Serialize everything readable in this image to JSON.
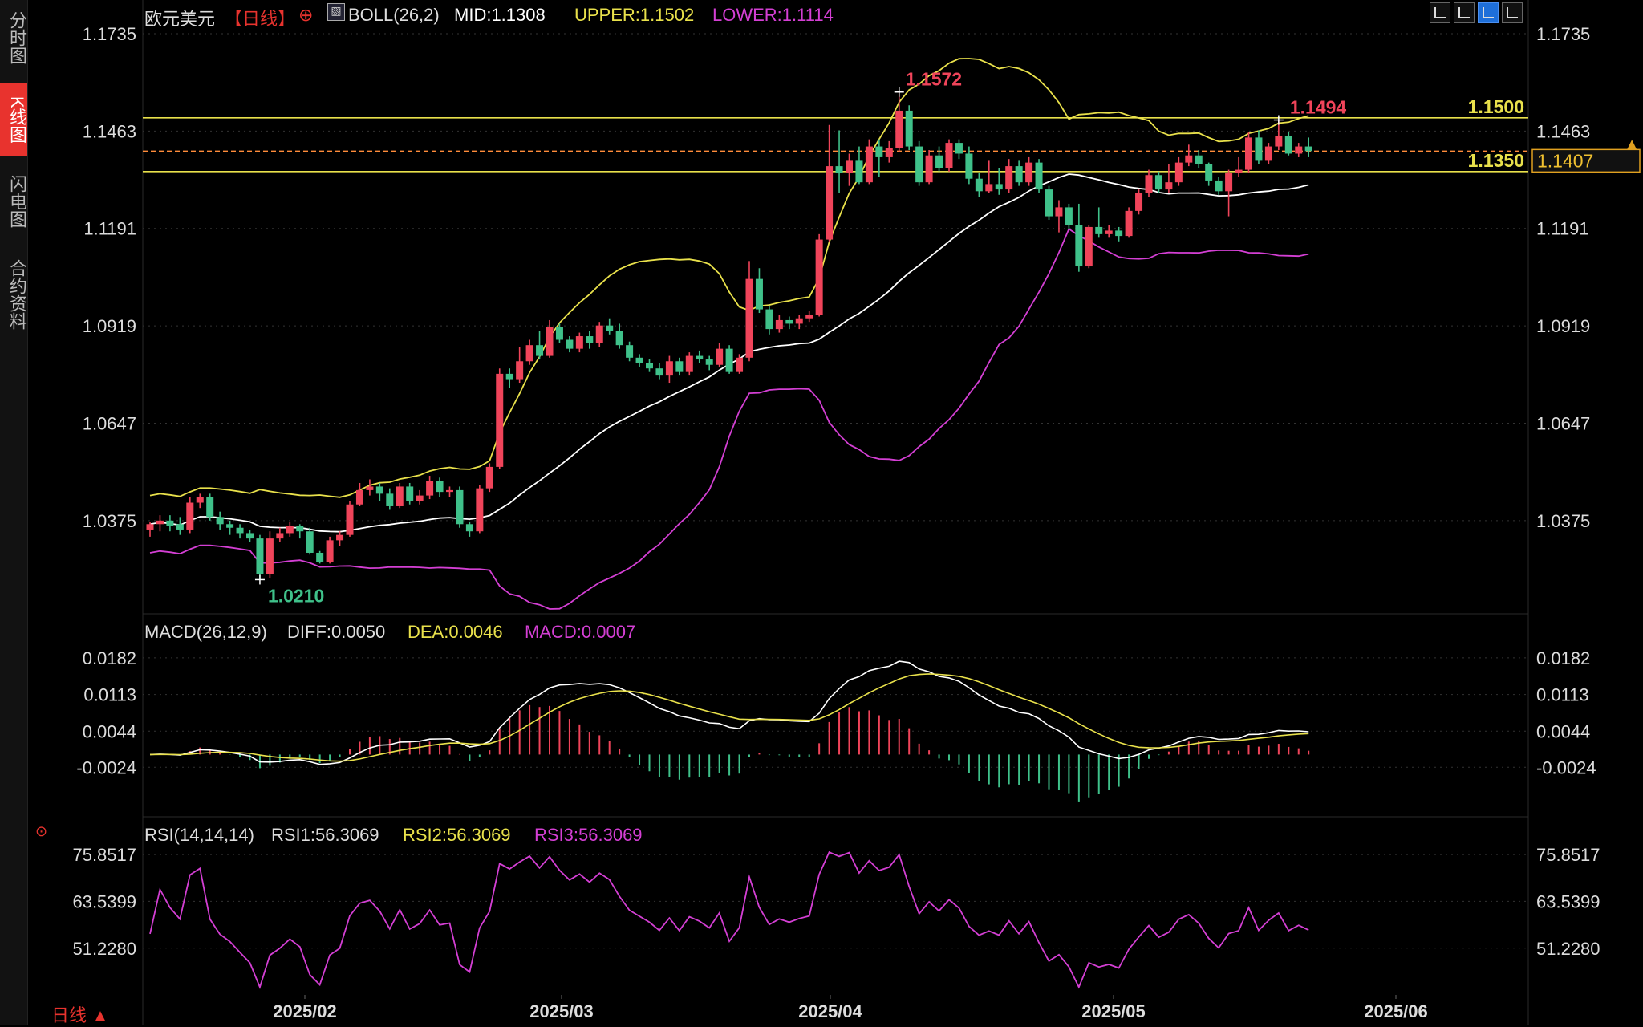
{
  "side_tabs": [
    {
      "label": "分时图",
      "active": false
    },
    {
      "label": "K线图",
      "active": true
    },
    {
      "label": "闪电图",
      "active": false
    },
    {
      "label": "合约资料",
      "active": false
    }
  ],
  "header": {
    "symbol": "欧元美元",
    "period_tag": "【日线】",
    "boll_label": "BOLL(26,2)",
    "mid_label": "MID:1.1308",
    "upper_label": "UPPER:1.1502",
    "lower_label": "LOWER:1.1114"
  },
  "macd_header": {
    "name": "MACD(26,12,9)",
    "diff_label": "DIFF:0.0050",
    "dea_label": "DEA:0.0046",
    "macd_label": "MACD:0.0007"
  },
  "rsi_header": {
    "name": "RSI(14,14,14)",
    "rsi1_label": "RSI1:56.3069",
    "rsi2_label": "RSI2:56.3069",
    "rsi3_label": "RSI3:56.3069"
  },
  "bottom": {
    "period_label": "日线 ▲"
  },
  "colors": {
    "up": "#f0445a",
    "down": "#3fc18a",
    "mid": "#ffffff",
    "upper": "#e9e14b",
    "lower": "#d43fd4",
    "grid": "#333333",
    "hline": "#e9e14b",
    "last_line": "#ff8c3a"
  },
  "chart_data": [
    {
      "type": "candlestick",
      "panel": "price",
      "y_ticks": [
        "1.1735",
        "1.1463",
        "1.1191",
        "1.0919",
        "1.0647",
        "1.0375"
      ],
      "ylim": [
        1.0211,
        1.1735
      ],
      "x_ticks": [
        "2025/02",
        "2025/03",
        "2025/04",
        "2025/05",
        "2025/06"
      ],
      "annotations": {
        "high": "1.1572",
        "low": "1.0210",
        "recent_high": "1.1494"
      },
      "horizontal_lines": [
        {
          "label": "1.1500",
          "value": 1.15
        },
        {
          "label": "1.1350",
          "value": 1.135
        }
      ],
      "last_price": {
        "label": "1.1407",
        "value": 1.1407
      },
      "candles": [
        [
          1.035,
          1.0365,
          1.033,
          1.037
        ],
        [
          1.0365,
          1.0375,
          1.0345,
          1.039
        ],
        [
          1.0375,
          1.036,
          1.0345,
          1.039
        ],
        [
          1.0365,
          1.035,
          1.0335,
          1.0385
        ],
        [
          1.035,
          1.0425,
          1.034,
          1.044
        ],
        [
          1.0425,
          1.044,
          1.041,
          1.045
        ],
        [
          1.044,
          1.0385,
          1.0375,
          1.045
        ],
        [
          1.0385,
          1.0365,
          1.035,
          1.04
        ],
        [
          1.0365,
          1.0355,
          1.0335,
          1.0375
        ],
        [
          1.0355,
          1.034,
          1.0325,
          1.0365
        ],
        [
          1.034,
          1.0325,
          1.0315,
          1.035
        ],
        [
          1.0325,
          1.0225,
          1.021,
          1.0335
        ],
        [
          1.0225,
          1.0325,
          1.0215,
          1.0345
        ],
        [
          1.0325,
          1.034,
          1.0315,
          1.0355
        ],
        [
          1.034,
          1.036,
          1.033,
          1.037
        ],
        [
          1.036,
          1.0345,
          1.0325,
          1.0365
        ],
        [
          1.0345,
          1.0285,
          1.028,
          1.0355
        ],
        [
          1.0285,
          1.026,
          1.0255,
          1.029
        ],
        [
          1.026,
          1.032,
          1.0255,
          1.033
        ],
        [
          1.032,
          1.0335,
          1.0305,
          1.0345
        ],
        [
          1.0335,
          1.042,
          1.033,
          1.043
        ],
        [
          1.042,
          1.046,
          1.0415,
          1.048
        ],
        [
          1.046,
          1.047,
          1.0445,
          1.049
        ],
        [
          1.047,
          1.045,
          1.043,
          1.048
        ],
        [
          1.045,
          1.0415,
          1.0405,
          1.0465
        ],
        [
          1.0415,
          1.047,
          1.041,
          1.048
        ],
        [
          1.047,
          1.043,
          1.042,
          1.048
        ],
        [
          1.043,
          1.0445,
          1.042,
          1.046
        ],
        [
          1.0445,
          1.0485,
          1.0435,
          1.05
        ],
        [
          1.0485,
          1.0455,
          1.044,
          1.0495
        ],
        [
          1.0455,
          1.046,
          1.044,
          1.047
        ],
        [
          1.046,
          1.0365,
          1.0355,
          1.047
        ],
        [
          1.0365,
          1.0345,
          1.033,
          1.037
        ],
        [
          1.0345,
          1.0465,
          1.034,
          1.0475
        ],
        [
          1.0465,
          1.0525,
          1.0455,
          1.0535
        ],
        [
          1.0525,
          1.0785,
          1.052,
          1.08
        ],
        [
          1.0785,
          1.077,
          1.0745,
          1.08
        ],
        [
          1.077,
          1.082,
          1.076,
          1.086
        ],
        [
          1.082,
          1.0865,
          1.081,
          1.088
        ],
        [
          1.0865,
          1.0835,
          1.0825,
          1.0905
        ],
        [
          1.0835,
          1.0915,
          1.083,
          1.0935
        ],
        [
          1.0915,
          1.088,
          1.087,
          1.0925
        ],
        [
          1.088,
          1.0855,
          1.0845,
          1.089
        ],
        [
          1.0855,
          1.089,
          1.0845,
          1.09
        ],
        [
          1.089,
          1.087,
          1.0855,
          1.0905
        ],
        [
          1.087,
          1.092,
          1.086,
          1.093
        ],
        [
          1.092,
          1.0905,
          1.0895,
          1.094
        ],
        [
          1.0905,
          1.0865,
          1.0855,
          1.0925
        ],
        [
          1.0865,
          1.083,
          1.082,
          1.0875
        ],
        [
          1.083,
          1.0815,
          1.0805,
          1.084
        ],
        [
          1.0815,
          1.08,
          1.079,
          1.0825
        ],
        [
          1.08,
          1.078,
          1.077,
          1.0815
        ],
        [
          1.078,
          1.082,
          1.076,
          1.0835
        ],
        [
          1.082,
          1.079,
          1.078,
          1.083
        ],
        [
          1.079,
          1.0835,
          1.078,
          1.0845
        ],
        [
          1.0835,
          1.0825,
          1.0815,
          1.085
        ],
        [
          1.0825,
          1.081,
          1.0795,
          1.0835
        ],
        [
          1.081,
          1.0855,
          1.0805,
          1.087
        ],
        [
          1.0855,
          1.079,
          1.0785,
          1.0865
        ],
        [
          1.079,
          1.083,
          1.0785,
          1.084
        ],
        [
          1.083,
          1.105,
          1.082,
          1.11
        ],
        [
          1.105,
          1.0965,
          1.0955,
          1.108
        ],
        [
          1.0965,
          1.091,
          1.0895,
          1.0975
        ],
        [
          1.091,
          1.0935,
          1.09,
          1.095
        ],
        [
          1.0935,
          1.0925,
          1.091,
          1.0945
        ],
        [
          1.0925,
          1.094,
          1.091,
          1.095
        ],
        [
          1.094,
          1.095,
          1.093,
          1.096
        ],
        [
          1.095,
          1.116,
          1.0945,
          1.1175
        ],
        [
          1.116,
          1.1365,
          1.1155,
          1.148
        ],
        [
          1.1365,
          1.1345,
          1.129,
          1.1465
        ],
        [
          1.1345,
          1.138,
          1.131,
          1.14
        ],
        [
          1.138,
          1.132,
          1.1315,
          1.142
        ],
        [
          1.132,
          1.142,
          1.1315,
          1.144
        ],
        [
          1.142,
          1.139,
          1.1335,
          1.144
        ],
        [
          1.139,
          1.1415,
          1.1375,
          1.1435
        ],
        [
          1.1415,
          1.152,
          1.1405,
          1.1572
        ],
        [
          1.152,
          1.142,
          1.141,
          1.1535
        ],
        [
          1.142,
          1.132,
          1.131,
          1.1435
        ],
        [
          1.132,
          1.1395,
          1.1315,
          1.141
        ],
        [
          1.1395,
          1.136,
          1.135,
          1.142
        ],
        [
          1.136,
          1.143,
          1.135,
          1.144
        ],
        [
          1.143,
          1.14,
          1.1385,
          1.144
        ],
        [
          1.14,
          1.133,
          1.1315,
          1.142
        ],
        [
          1.133,
          1.1295,
          1.128,
          1.1345
        ],
        [
          1.1295,
          1.1315,
          1.129,
          1.138
        ],
        [
          1.1315,
          1.13,
          1.1285,
          1.136
        ],
        [
          1.13,
          1.1365,
          1.129,
          1.1385
        ],
        [
          1.1365,
          1.132,
          1.131,
          1.138
        ],
        [
          1.132,
          1.1375,
          1.131,
          1.139
        ],
        [
          1.1375,
          1.13,
          1.129,
          1.1385
        ],
        [
          1.13,
          1.1225,
          1.1215,
          1.131
        ],
        [
          1.1225,
          1.125,
          1.118,
          1.127
        ],
        [
          1.125,
          1.12,
          1.119,
          1.126
        ],
        [
          1.12,
          1.1085,
          1.107,
          1.126
        ],
        [
          1.1085,
          1.1195,
          1.108,
          1.12
        ],
        [
          1.1195,
          1.1175,
          1.1165,
          1.125
        ],
        [
          1.1175,
          1.1185,
          1.1165,
          1.12
        ],
        [
          1.1185,
          1.117,
          1.1155,
          1.1195
        ],
        [
          1.117,
          1.124,
          1.1165,
          1.125
        ],
        [
          1.124,
          1.129,
          1.123,
          1.13
        ],
        [
          1.129,
          1.134,
          1.128,
          1.1355
        ],
        [
          1.134,
          1.13,
          1.129,
          1.135
        ],
        [
          1.13,
          1.132,
          1.129,
          1.137
        ],
        [
          1.132,
          1.1375,
          1.131,
          1.139
        ],
        [
          1.1375,
          1.1395,
          1.1365,
          1.1425
        ],
        [
          1.1395,
          1.137,
          1.136,
          1.141
        ],
        [
          1.137,
          1.1325,
          1.131,
          1.1375
        ],
        [
          1.1325,
          1.1295,
          1.1285,
          1.1335
        ],
        [
          1.1295,
          1.1345,
          1.1225,
          1.1355
        ],
        [
          1.1345,
          1.1355,
          1.1335,
          1.139
        ],
        [
          1.1355,
          1.1445,
          1.1345,
          1.146
        ],
        [
          1.1445,
          1.138,
          1.137,
          1.1465
        ],
        [
          1.138,
          1.142,
          1.137,
          1.143
        ],
        [
          1.142,
          1.145,
          1.141,
          1.1494
        ],
        [
          1.145,
          1.14,
          1.1395,
          1.146
        ],
        [
          1.14,
          1.142,
          1.139,
          1.143
        ],
        [
          1.142,
          1.1407,
          1.139,
          1.1445
        ]
      ]
    },
    {
      "type": "macd",
      "panel": "macd",
      "y_ticks": [
        "0.0182",
        "0.0113",
        "0.0044",
        "-0.0024"
      ],
      "ylim": [
        -0.009,
        0.02
      ]
    },
    {
      "type": "line",
      "panel": "rsi",
      "y_ticks": [
        "75.8517",
        "63.5399",
        "51.2280"
      ],
      "ylim": [
        40.0,
        76.5
      ]
    }
  ]
}
